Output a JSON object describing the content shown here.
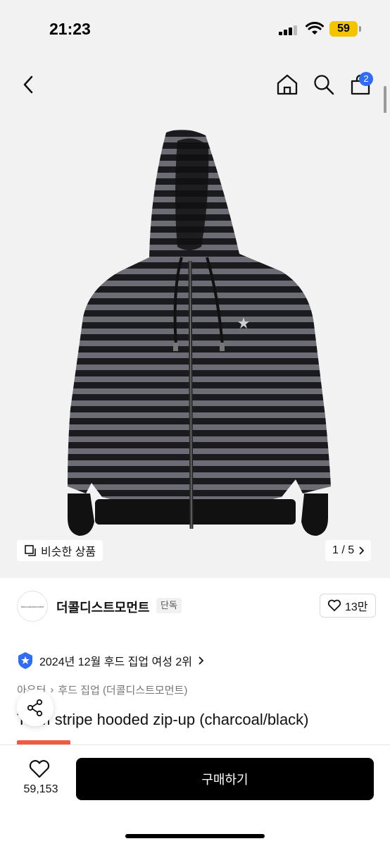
{
  "status_bar": {
    "time": "21:23",
    "battery": "59"
  },
  "header": {
    "cart_count": "2"
  },
  "gallery": {
    "similar_label": "비슷한 상품",
    "counter": "1 / 5"
  },
  "brand": {
    "logo_text": "thecoolestmoment",
    "name": "더콜디스트모먼트",
    "tag": "단독",
    "likes": "13만"
  },
  "ranking": {
    "text": "2024년 12월 후드 집업 여성 2위"
  },
  "breadcrumb": {
    "category": "아우터",
    "subcategory": "후드 집업 (더콜디스트모먼트)"
  },
  "product": {
    "title": "TCM stripe hooded zip-up (charcoal/black)"
  },
  "bottom_bar": {
    "wish_count": "59,153",
    "buy_label": "구매하기"
  },
  "colors": {
    "accent_blue": "#2f6df6",
    "discount_red": "#ef5a44",
    "stripe_grey": "#6b6c73",
    "stripe_black": "#1a1a1d"
  }
}
